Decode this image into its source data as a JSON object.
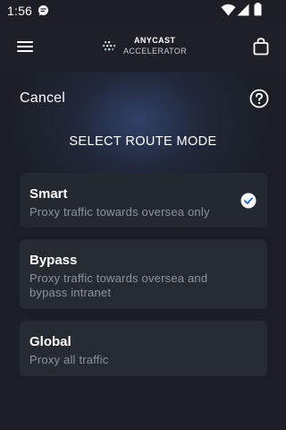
{
  "status_bar": {
    "time": "1:56",
    "icons": [
      "notification-icon",
      "wifi-icon",
      "signal-icon",
      "battery-icon"
    ]
  },
  "header": {
    "menu_icon": "hamburger-menu-icon",
    "brand_name": "ANYCAST",
    "brand_sub": "ACCELERATOR",
    "cart_icon": "shopping-bag-icon"
  },
  "sheet": {
    "cancel_label": "Cancel",
    "help_icon": "help-circle-icon",
    "title": "SELECT ROUTE MODE",
    "options": [
      {
        "name": "Smart",
        "description": "Proxy traffic towards oversea only",
        "selected": true
      },
      {
        "name": "Bypass",
        "description": "Proxy traffic towards oversea and bypass intranet",
        "selected": false
      },
      {
        "name": "Global",
        "description": "Proxy all traffic",
        "selected": false
      }
    ]
  },
  "colors": {
    "background": "#1b1e25",
    "card": "#262a31",
    "muted_text": "#8e939b",
    "accent_glow": "#344876",
    "check_color": "#1f5fd0"
  }
}
